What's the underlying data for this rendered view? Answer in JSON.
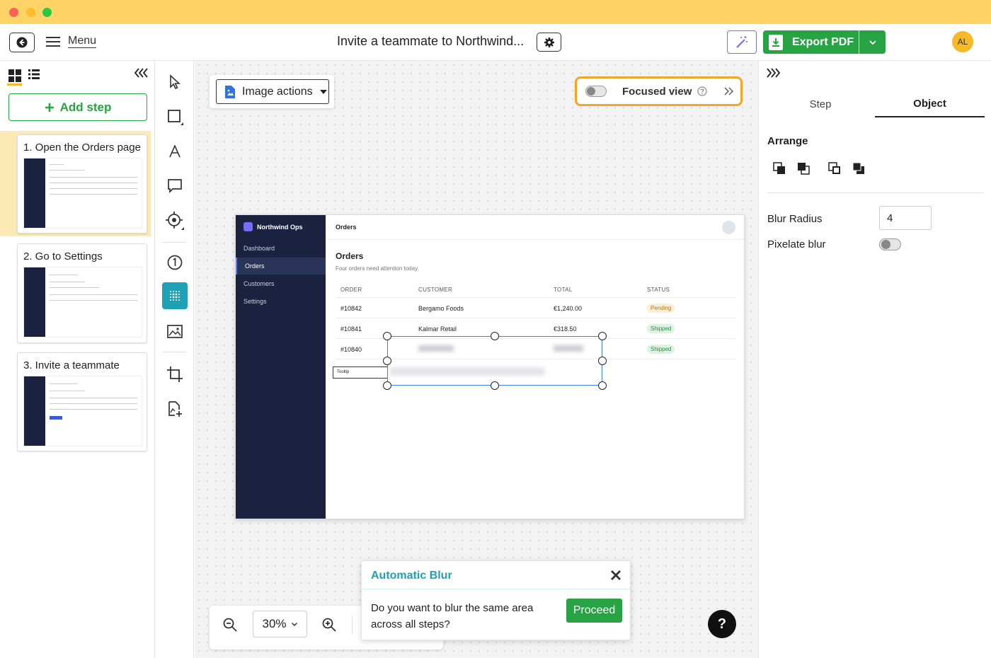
{
  "header": {
    "menu_label": "Menu",
    "doc_title": "Invite a teammate to Northwind...",
    "export_label": "Export PDF",
    "avatar_initials": "AL"
  },
  "left_panel": {
    "add_step_label": "Add step",
    "steps": [
      {
        "title": "1. Open the Orders page"
      },
      {
        "title": "2. Go to Settings"
      },
      {
        "title": "3. Invite a teammate"
      }
    ]
  },
  "canvas": {
    "image_actions_label": "Image actions",
    "focused_view_label": "Focused view",
    "zoom_value": "30%"
  },
  "screenshot": {
    "brand": "Northwind Ops",
    "nav": [
      "Dashboard",
      "Orders",
      "Customers",
      "Settings"
    ],
    "top_title": "Orders",
    "heading": "Orders",
    "subheading": "Four orders need attention today.",
    "columns": [
      "ORDER",
      "CUSTOMER",
      "TOTAL",
      "STATUS"
    ],
    "rows": [
      {
        "order": "#10842",
        "customer": "Bergamo Foods",
        "total": "€1,240.00",
        "status": "Pending"
      },
      {
        "order": "#10841",
        "customer": "Kalmar Retail",
        "total": "€318.50",
        "status": "Shipped"
      },
      {
        "order": "#10840",
        "customer": "",
        "total": "",
        "status": "Shipped"
      }
    ],
    "tooltip_label": "Tooltip"
  },
  "blur_popup": {
    "title": "Automatic Blur",
    "message": "Do you want to blur the same area across all steps?",
    "proceed_label": "Proceed"
  },
  "help_label": "?",
  "right_panel": {
    "tabs": [
      "Step",
      "Object"
    ],
    "arrange_label": "Arrange",
    "blur_radius_label": "Blur Radius",
    "blur_radius_value": "4",
    "pixelate_label": "Pixelate blur"
  },
  "colors": {
    "titlebar": "#ffd366",
    "accent_green": "#27a344",
    "teal": "#1fa0b5",
    "highlight_orange": "#f5a524",
    "sidebar_navy": "#1a2240"
  }
}
